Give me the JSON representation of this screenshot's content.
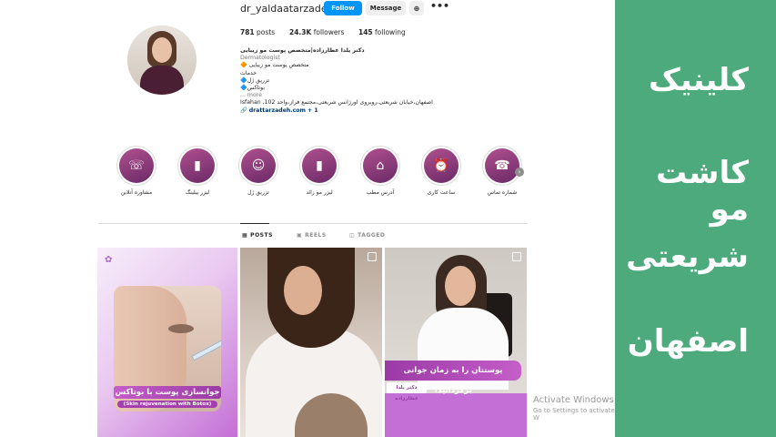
{
  "profile": {
    "username": "dr_yaldaatarzadeh",
    "follow_label": "Follow",
    "message_label": "Message",
    "posts_count": "781",
    "posts_label": "posts",
    "followers_count": "24.3K",
    "followers_label": "followers",
    "following_count": "145",
    "following_label": "following"
  },
  "bio": {
    "name": "دکتر یلدا عطارزاده|متخصص پوست مو زیبایی",
    "category": "Dermatologist",
    "line1": "متخصص پوست مو زیبایی 🔶",
    "line2": "خدمات",
    "line3": "تزریق ژل🔷",
    "line4": "بوتاکس🔷",
    "more": "... more",
    "address": "اصفهان،خیابان شریعتی،روبروی اورژانس شریعتی،مجتمع فراز،واحد 102, Isfahan",
    "link": "drattarzadeh.com",
    "link_extra": "+ 1"
  },
  "highlights": [
    {
      "label": "شماره تماس",
      "icon": "contact-icon"
    },
    {
      "label": "ساعت کاری",
      "icon": "clock-icon"
    },
    {
      "label": "آدرس مطب",
      "icon": "location-icon"
    },
    {
      "label": "لیزر مو زائد",
      "icon": "laser-device-icon"
    },
    {
      "label": "تزریق ژل",
      "icon": "face-injection-icon"
    },
    {
      "label": "لیزر بیلینگ",
      "icon": "laser-device-icon"
    },
    {
      "label": "مشاوره آنلاین",
      "icon": "consult-icon"
    }
  ],
  "tabs": {
    "posts": "POSTS",
    "reels": "REELS",
    "tagged": "TAGGED"
  },
  "posts": {
    "post1_title": "جوانسازی پوست با بوتاکس",
    "post1_sub": "(Skin rejuvenation with Botox)",
    "post3_banner": "پوستتان را به زمان جوانی برگردانید!",
    "post3_sub": "دکتر یلدا عطارزاده"
  },
  "watermark": {
    "title": "Activate Windows",
    "sub": "Go to Settings to activate W"
  },
  "side_banner": {
    "line1": "کلینیک",
    "line2": "کاشت مو",
    "line3": "شریعتی",
    "line4": "اصفهان"
  },
  "colors": {
    "accent": "#0095f6",
    "brand_purple": "#9b3aa6",
    "side_green": "#4caa7c"
  }
}
